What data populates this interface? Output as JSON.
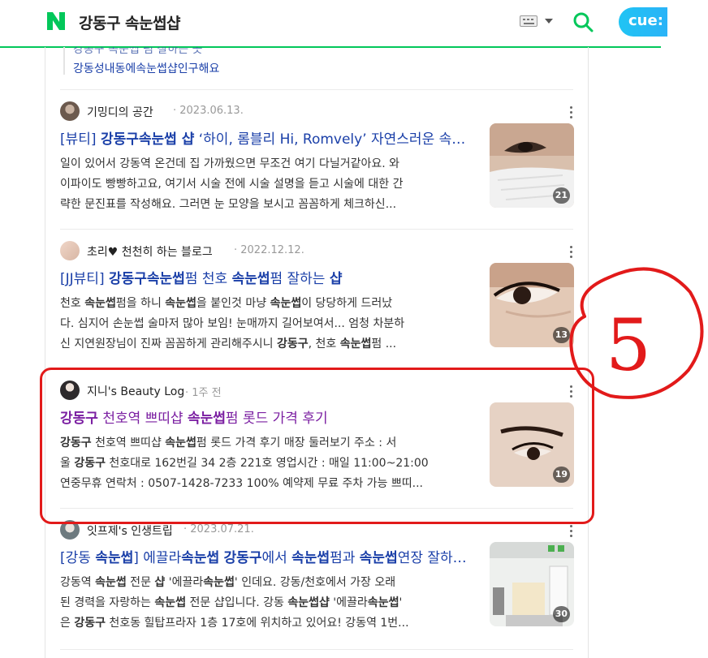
{
  "header": {
    "logo": "N",
    "query": "강동구 속눈썹샵",
    "cue_label": "cue:",
    "brand_color": "#03c75a"
  },
  "related": {
    "cut_text": "강동구 속눈썹 펌 잘하는 곳",
    "link_text": "강동성내동에속눈썹샵인구해요"
  },
  "results": [
    {
      "blog": "기밍디의 공간",
      "date": "2023.06.13.",
      "title": "[뷰티] 강동구속눈썹 샵 ‘하이, 롬블리 Hi, Romvely’ 자연스러운 속눈썹",
      "desc": [
        "일이 있어서 강동역 온건데 집 가까웠으면 무조건 여기 다닐거같아요. 와",
        "이파이도 빵빵하고요, 여기서 시술 전에 시술 설명을 듣고 시술에 대한 간",
        "략한 문진표를 작성해요. 그러면 눈 모양을 보시고 꼼꼼하게 체크하신..."
      ],
      "count": "21"
    },
    {
      "blog": "초리♥ 천천히 하는 블로그",
      "date": "2022.12.12.",
      "title": "[JJ뷰티] 강동구속눈썹펌 천호 속눈썹펌 잘하는 샵",
      "desc": [
        "천호 속눈썹펌을 하니 속눈썹을 붙인것 마냥 속눈썹이 당당하게 드러났",
        "다. 심지어 손눈썹 술마저 많아 보임! 눈매까지 길어보여서... 엄청 차분하",
        "신 지연원장님이 진짜 꼼꼼하게 관리해주시니 강동구, 천호 속눈썹펌 ..."
      ],
      "count": "13"
    },
    {
      "blog": "지니's Beauty Log",
      "date": "1주 전",
      "title": "강동구 천호역 쁘띠샵 속눈썹펌 롯드 가격 후기",
      "desc": [
        "강동구 천호역 쁘띠샵 속눈썹펌 롯드 가격 후기 매장 둘러보기 주소 : 서",
        "울 강동구 천호대로 162번길 34 2층 221호 영업시간 : 매일 11:00~21:00",
        "연중무휴 연락처 : 0507-1428-7233 100% 예약제 무료 주차 가능 쁘띠..."
      ],
      "count": "19"
    },
    {
      "blog": "잇프제's 인생트립",
      "date": "2023.07.21.",
      "title": "[강동 속눈썹] 에끌라속눈썹 강동구에서 속눈썹펌과 속눈썹연장 잘하는 곳",
      "desc": [
        "강동역 속눈썹 전문 샵 '에끌라속눈썹' 인데요. 강동/천호에서 가장 오래",
        "된 경력을 자랑하는 속눈썹 전문 샵입니다. 강동 속눈썹샵 '에끌라속눈썹'",
        "은 강동구 천호동 힐탑프라자 1층 17호에 위치하고 있어요! 강동역 1번..."
      ],
      "count": "30"
    }
  ],
  "annotation": {
    "label": "5",
    "color": "#e21a1a"
  }
}
